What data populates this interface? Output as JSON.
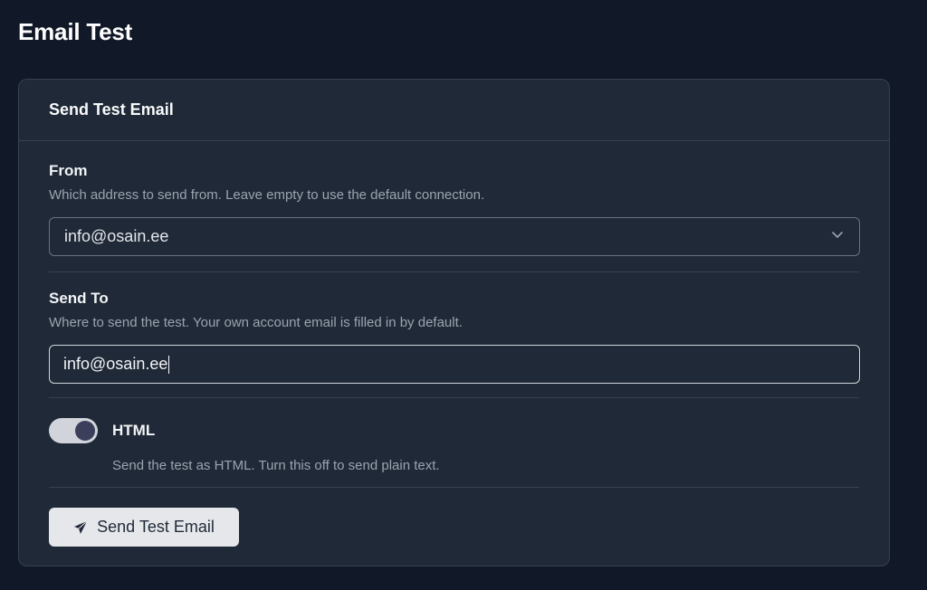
{
  "page": {
    "title": "Email Test"
  },
  "card": {
    "title": "Send Test Email"
  },
  "from": {
    "label": "From",
    "help": "Which address to send from. Leave empty to use the default connection.",
    "selected": "info@osain.ee",
    "icon": "chevron-down-icon"
  },
  "send_to": {
    "label": "Send To",
    "help": "Where to send the test. Your own account email is filled in by default.",
    "value": "info@osain.ee"
  },
  "html_toggle": {
    "label": "HTML",
    "help": "Send the test as HTML. Turn this off to send plain text.",
    "enabled": true
  },
  "submit": {
    "label": "Send Test Email",
    "icon": "paper-plane-icon"
  },
  "colors": {
    "background": "#111827",
    "card": "#1f2937",
    "border": "#374151",
    "button": "#e5e7eb"
  }
}
